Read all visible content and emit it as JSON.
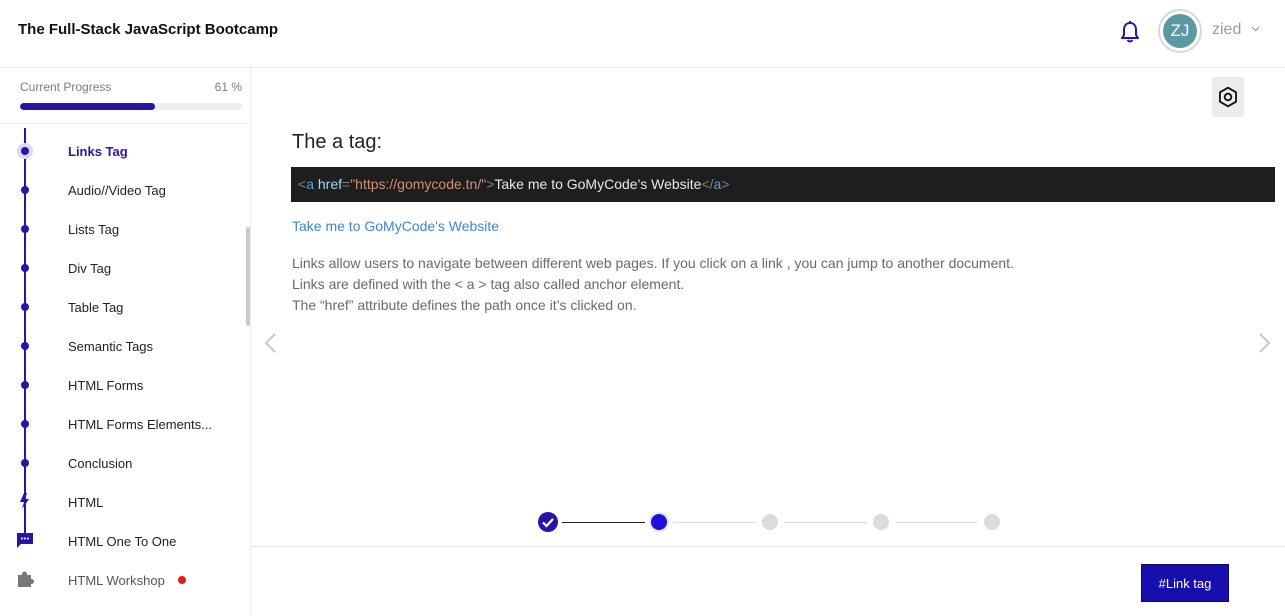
{
  "header": {
    "course_title": "The Full-Stack JavaScript Bootcamp",
    "avatar_initials": "ZJ",
    "username": "zied",
    "icons": [
      "bell-icon",
      "chevron-down-icon"
    ]
  },
  "sidebar": {
    "progress_label": "Current Progress",
    "progress_value": "61 %",
    "progress_fraction": 0.61,
    "accent_color": "#2a14a8",
    "items": [
      {
        "label": "Links Tag",
        "state": "active"
      },
      {
        "label": "Audio//Video Tag"
      },
      {
        "label": "Lists Tag"
      },
      {
        "label": "Div Tag"
      },
      {
        "label": "Table Tag"
      },
      {
        "label": "Semantic Tags"
      },
      {
        "label": "HTML Forms"
      },
      {
        "label": "HTML Forms Elements..."
      },
      {
        "label": "Conclusion"
      },
      {
        "label": "HTML",
        "icon": "lightning-icon"
      },
      {
        "label": "HTML One To One",
        "icon": "chat-icon"
      },
      {
        "label": "HTML Workshop",
        "icon": "puzzle-icon",
        "notification_dot": "#e51b1b"
      }
    ]
  },
  "main": {
    "heading": "The a tag:",
    "code": {
      "open_lt": "<",
      "tag": "a",
      "attr": "href",
      "eq": "=",
      "value": "\"https://gomycode.tn/\"",
      "open_gt": ">",
      "text": "Take me to GoMyCode's Website",
      "close_lt": "</",
      "close_tag": "a",
      "close_gt": ">"
    },
    "demo_link": "Take me to GoMyCode's Website",
    "paragraph_lines": [
      "Links allow users to navigate between different web pages. If you click on a link , you can jump to another document.",
      "Links are defined with the < a > tag also called anchor element.",
      "The “href” attribute defines the path once it’s clicked on."
    ],
    "stepper": {
      "total_steps": 5,
      "current_step": 2,
      "completed_steps": 1
    },
    "tag_button": "#Link tag",
    "icons": [
      "settings-icon",
      "chevron-left-icon",
      "chevron-right-icon",
      "check-icon"
    ]
  }
}
